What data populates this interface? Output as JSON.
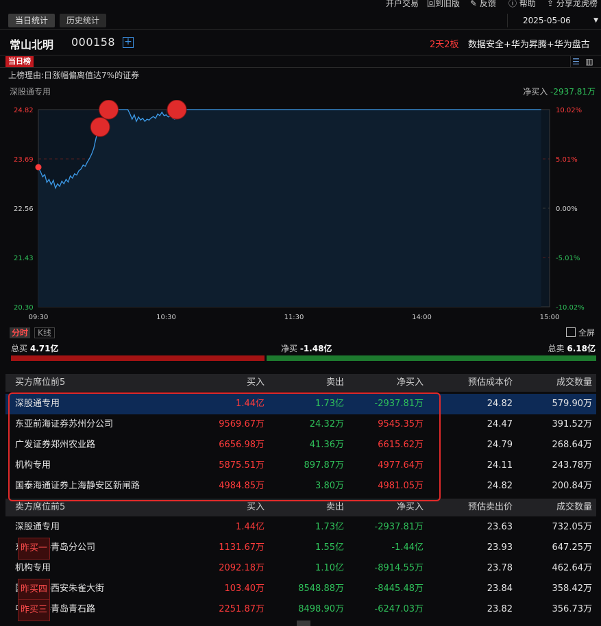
{
  "topbar": {
    "items": [
      "开户交易",
      "回到旧版",
      "反馈",
      "帮助",
      "分享龙虎榜"
    ]
  },
  "tabs": [
    "当日统计",
    "历史统计"
  ],
  "date": "2025-05-06",
  "stock": {
    "name": "常山北明",
    "code": "000158",
    "boards": "2天2板",
    "concepts": "数据安全+华为昇腾+华为盘古"
  },
  "day_tag": "当日榜",
  "reason": "上榜理由:日涨幅偏离值达7%的证券",
  "chart_head": {
    "left": "深股通专用",
    "net_label": "净买入",
    "net_value": "-2937.81万"
  },
  "chart_data": {
    "type": "line",
    "y_ticks_left": [
      "24.82",
      "23.69",
      "22.56",
      "21.43",
      "20.30"
    ],
    "y_ticks_right": [
      "10.02%",
      "5.01%",
      "0.00%",
      "-5.01%",
      "-10.02%"
    ],
    "x_ticks": [
      "09:30",
      "10:30",
      "11:30",
      "14:00",
      "15:00"
    ],
    "ylim": [
      20.3,
      24.82
    ],
    "prev_close": 22.56,
    "series": [
      {
        "values": [
          23.48,
          23.4,
          23.28,
          23.33,
          23.15,
          23.22,
          23.1,
          23.2,
          23.02,
          23.12,
          23.06,
          23.18,
          23.12,
          23.22,
          23.16,
          23.3,
          23.25,
          23.35,
          23.32,
          23.42,
          23.46,
          23.55,
          23.52,
          23.62,
          23.7,
          23.8,
          23.93,
          24.15,
          24.35,
          24.45,
          24.5,
          24.6,
          24.82,
          24.82,
          24.82,
          24.82,
          24.82,
          24.82,
          24.82,
          24.82,
          24.82,
          24.82,
          24.82,
          24.72,
          24.6,
          24.7,
          24.55,
          24.65,
          24.58,
          24.62,
          24.55,
          24.6,
          24.58,
          24.63,
          24.66,
          24.62,
          24.72,
          24.68,
          24.76,
          24.68,
          24.7,
          24.65,
          24.68,
          24.62,
          24.6,
          24.82,
          24.82,
          24.82,
          24.82,
          24.82,
          24.82,
          24.82,
          24.82,
          24.82,
          24.82,
          24.82,
          24.82,
          24.82,
          24.82,
          24.82,
          24.82,
          24.82,
          24.82,
          24.82,
          24.82,
          24.82,
          24.82,
          24.82,
          24.82,
          24.82,
          24.82,
          24.82,
          24.82,
          24.82,
          24.82,
          24.82,
          24.82,
          24.82,
          24.82,
          24.82,
          24.82,
          24.82,
          24.82,
          24.82,
          24.82,
          24.82,
          24.82,
          24.82,
          24.82,
          24.82,
          24.82,
          24.82,
          24.82,
          24.82,
          24.82,
          24.82,
          24.82,
          24.82,
          24.82,
          24.82,
          24.82,
          24.82,
          24.82,
          24.82,
          24.82,
          24.82,
          24.82,
          24.82,
          24.82,
          24.82,
          24.82,
          24.82,
          24.82,
          24.82,
          24.82,
          24.82,
          24.82,
          24.82,
          24.82,
          24.82,
          24.82,
          24.82,
          24.82,
          24.82,
          24.82,
          24.82,
          24.82,
          24.82,
          24.82,
          24.82,
          24.82,
          24.82,
          24.82,
          24.82,
          24.82,
          24.82,
          24.82,
          24.82,
          24.82,
          24.82,
          24.82,
          24.82,
          24.82,
          24.82,
          24.82,
          24.82,
          24.82,
          24.82,
          24.82,
          24.82,
          24.82,
          24.82,
          24.82,
          24.82,
          24.82,
          24.82,
          24.82,
          24.82,
          24.82,
          24.82,
          24.82,
          24.82,
          24.82,
          24.82,
          24.82,
          24.82,
          24.82,
          24.82,
          24.82,
          24.82,
          24.82,
          24.82,
          24.82,
          24.82,
          24.82,
          24.82,
          24.82,
          24.82,
          24.82,
          24.82,
          24.82,
          24.82,
          24.82,
          24.82,
          24.82,
          24.82,
          24.82,
          24.82,
          24.82,
          24.82,
          24.82,
          24.82,
          24.82,
          24.82,
          24.82,
          24.82,
          24.82,
          24.82,
          24.82,
          24.82,
          24.82,
          24.82,
          24.82,
          24.82,
          24.82,
          24.82,
          24.82,
          24.82,
          24.82,
          24.82,
          24.82,
          24.82,
          24.82,
          24.82,
          24.82,
          24.82,
          24.82
        ]
      }
    ],
    "markers": [
      {
        "index": 0,
        "value": 23.5,
        "kind": "small"
      },
      {
        "index": 29,
        "value": 24.42,
        "kind": "big"
      },
      {
        "index": 33,
        "value": 24.82,
        "kind": "big"
      },
      {
        "index": 65,
        "value": 24.82,
        "kind": "big"
      }
    ],
    "grid": true,
    "line_color": "#3d9be9",
    "up_color": "#ff3b3b",
    "down_color": "#2fc15a"
  },
  "chart_tabs": {
    "fenshi": "分时",
    "kline": "K线"
  },
  "fullscreen": "全屏",
  "totals": {
    "buy_label": "总买",
    "buy": "4.71亿",
    "net_label": "净买",
    "net": "-1.48亿",
    "sell_label": "总卖",
    "sell": "6.18亿",
    "buy_share": 0.433
  },
  "buy_table": {
    "headers": [
      "买方席位前5",
      "买入",
      "卖出",
      "净买入",
      "预估成本价",
      "成交数量"
    ],
    "rows": [
      {
        "name": "深股通专用",
        "buy": "1.44亿",
        "sell": "1.73亿",
        "net": "-2937.81万",
        "price": "24.82",
        "vol": "579.90万",
        "badge": ""
      },
      {
        "name": "东亚前海证券苏州分公司",
        "buy": "9569.67万",
        "sell": "24.32万",
        "net": "9545.35万",
        "price": "24.47",
        "vol": "391.52万",
        "badge": ""
      },
      {
        "name": "广发证券郑州农业路",
        "buy": "6656.98万",
        "sell": "41.36万",
        "net": "6615.62万",
        "price": "24.79",
        "vol": "268.64万",
        "badge": ""
      },
      {
        "name": "机构专用",
        "buy": "5875.51万",
        "sell": "897.87万",
        "net": "4977.64万",
        "price": "24.11",
        "vol": "243.78万",
        "badge": ""
      },
      {
        "name": "国泰海通证券上海静安区新闸路",
        "buy": "4984.85万",
        "sell": "3.80万",
        "net": "4981.05万",
        "price": "24.82",
        "vol": "200.84万",
        "badge": ""
      }
    ]
  },
  "sell_table": {
    "headers": [
      "卖方席位前5",
      "买入",
      "卖出",
      "净买入",
      "预估卖出价",
      "成交数量"
    ],
    "rows": [
      {
        "name": "深股通专用",
        "buy": "1.44亿",
        "sell": "1.73亿",
        "net": "-2937.81万",
        "price": "23.63",
        "vol": "732.05万",
        "badge": ""
      },
      {
        "name": "东北证券青岛分公司",
        "buy": "1131.67万",
        "sell": "1.55亿",
        "net": "-1.44亿",
        "price": "23.93",
        "vol": "647.25万",
        "badge": "昨买一"
      },
      {
        "name": "机构专用",
        "buy": "2092.18万",
        "sell": "1.10亿",
        "net": "-8914.55万",
        "price": "23.78",
        "vol": "462.64万",
        "badge": ""
      },
      {
        "name": "国投证券西安朱雀大街",
        "buy": "103.40万",
        "sell": "8548.88万",
        "net": "-8445.48万",
        "price": "23.84",
        "vol": "358.42万",
        "badge": "昨买四"
      },
      {
        "name": "中泰证券青岛青石路",
        "buy": "2251.87万",
        "sell": "8498.90万",
        "net": "-6247.03万",
        "price": "23.82",
        "vol": "356.73万",
        "badge": "昨买三"
      }
    ]
  }
}
